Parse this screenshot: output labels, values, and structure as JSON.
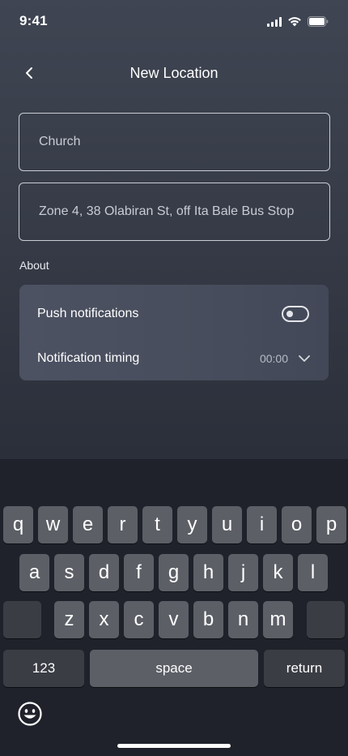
{
  "status_bar": {
    "time": "9:41"
  },
  "nav": {
    "title": "New Location"
  },
  "form": {
    "name_value": "Church",
    "address_value": "Zone 4, 38 Olabiran St, off Ita Bale Bus Stop"
  },
  "about": {
    "label": "About",
    "push_label": "Push notifications",
    "push_enabled": false,
    "timing_label": "Notification timing",
    "timing_value": "00:00"
  },
  "keyboard": {
    "row1": [
      "q",
      "w",
      "e",
      "r",
      "t",
      "y",
      "u",
      "i",
      "o",
      "p"
    ],
    "row2": [
      "a",
      "s",
      "d",
      "f",
      "g",
      "h",
      "j",
      "k",
      "l"
    ],
    "row3": [
      "z",
      "x",
      "c",
      "v",
      "b",
      "n",
      "m"
    ],
    "numbers_label": "123",
    "space_label": "space",
    "return_label": "return"
  }
}
